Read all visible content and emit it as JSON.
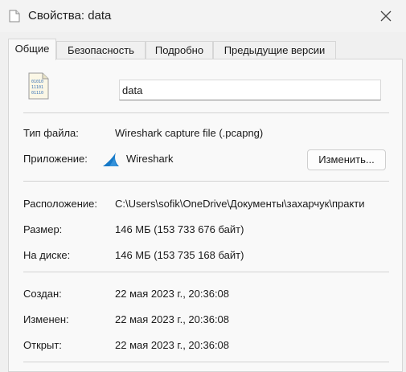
{
  "window": {
    "title": "Свойства: data"
  },
  "tabs": [
    {
      "label": "Общие",
      "active": true
    },
    {
      "label": "Безопасность"
    },
    {
      "label": "Подробно"
    },
    {
      "label": "Предыдущие версии"
    }
  ],
  "file": {
    "icon": "binary-file-icon",
    "name": "data"
  },
  "type_info": {
    "file_type_label": "Тип файла:",
    "file_type_value": "Wireshark capture file (.pcapng)",
    "app_label": "Приложение:",
    "app_icon": "wireshark-fin-icon",
    "app_name": "Wireshark",
    "change_button": "Изменить..."
  },
  "location_info": {
    "location_label": "Расположение:",
    "location_value": "C:\\Users\\sofik\\OneDrive\\Документы\\захарчук\\практи",
    "size_label": "Размер:",
    "size_value": "146 МБ (153 733 676 байт)",
    "ondisk_label": "На диске:",
    "ondisk_value": "146 МБ (153 735 168 байт)"
  },
  "dates": {
    "created_label": "Создан:",
    "created_value": "22 мая 2023 г., 20:36:08",
    "modified_label": "Изменен:",
    "modified_value": "22 мая 2023 г., 20:36:08",
    "opened_label": "Открыт:",
    "opened_value": "22 мая 2023 г., 20:36:08"
  },
  "colors": {
    "accent": "#1e6fd9",
    "wireshark": "#1679c8"
  }
}
